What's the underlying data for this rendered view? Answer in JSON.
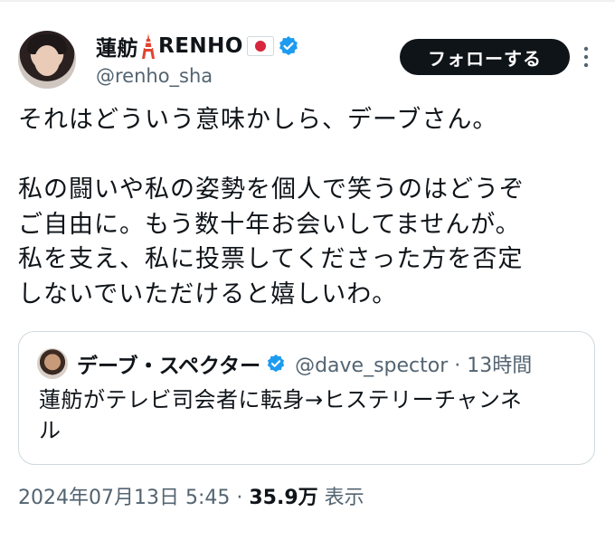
{
  "user": {
    "display_name": "蓮舫",
    "display_name_suffix": "RENHO",
    "handle": "@renho_sha",
    "tower_icon": "tokyo-tower-emoji",
    "flag_icon": "japan-flag-emoji",
    "verified": true
  },
  "follow_label": "フォローする",
  "tweet": {
    "line1": "それはどういう意味かしら、デーブさん。",
    "paragraph2": [
      "私の闘いや私の姿勢を個人で笑うのはどうぞ",
      "ご自由に。もう数十年お会いしてませんが。",
      "私を支え、私に投票してくださった方を否定",
      "しないでいただけると嬉しいわ。"
    ]
  },
  "quote": {
    "name": "デーブ・スペクター",
    "handle_time": "@dave_spector · 13時間",
    "text_line1": "蓮舫がテレビ司会者に転身→ヒステリーチャンネ",
    "text_line2": "ル"
  },
  "footer": {
    "timestamp": "2024年07月13日 5:45 · ",
    "views": "35.9万",
    "views_label": " 表示"
  },
  "colors": {
    "verified_blue": "#1d9bf0",
    "secondary_text": "#536471",
    "follow_bg": "#0f1419"
  }
}
